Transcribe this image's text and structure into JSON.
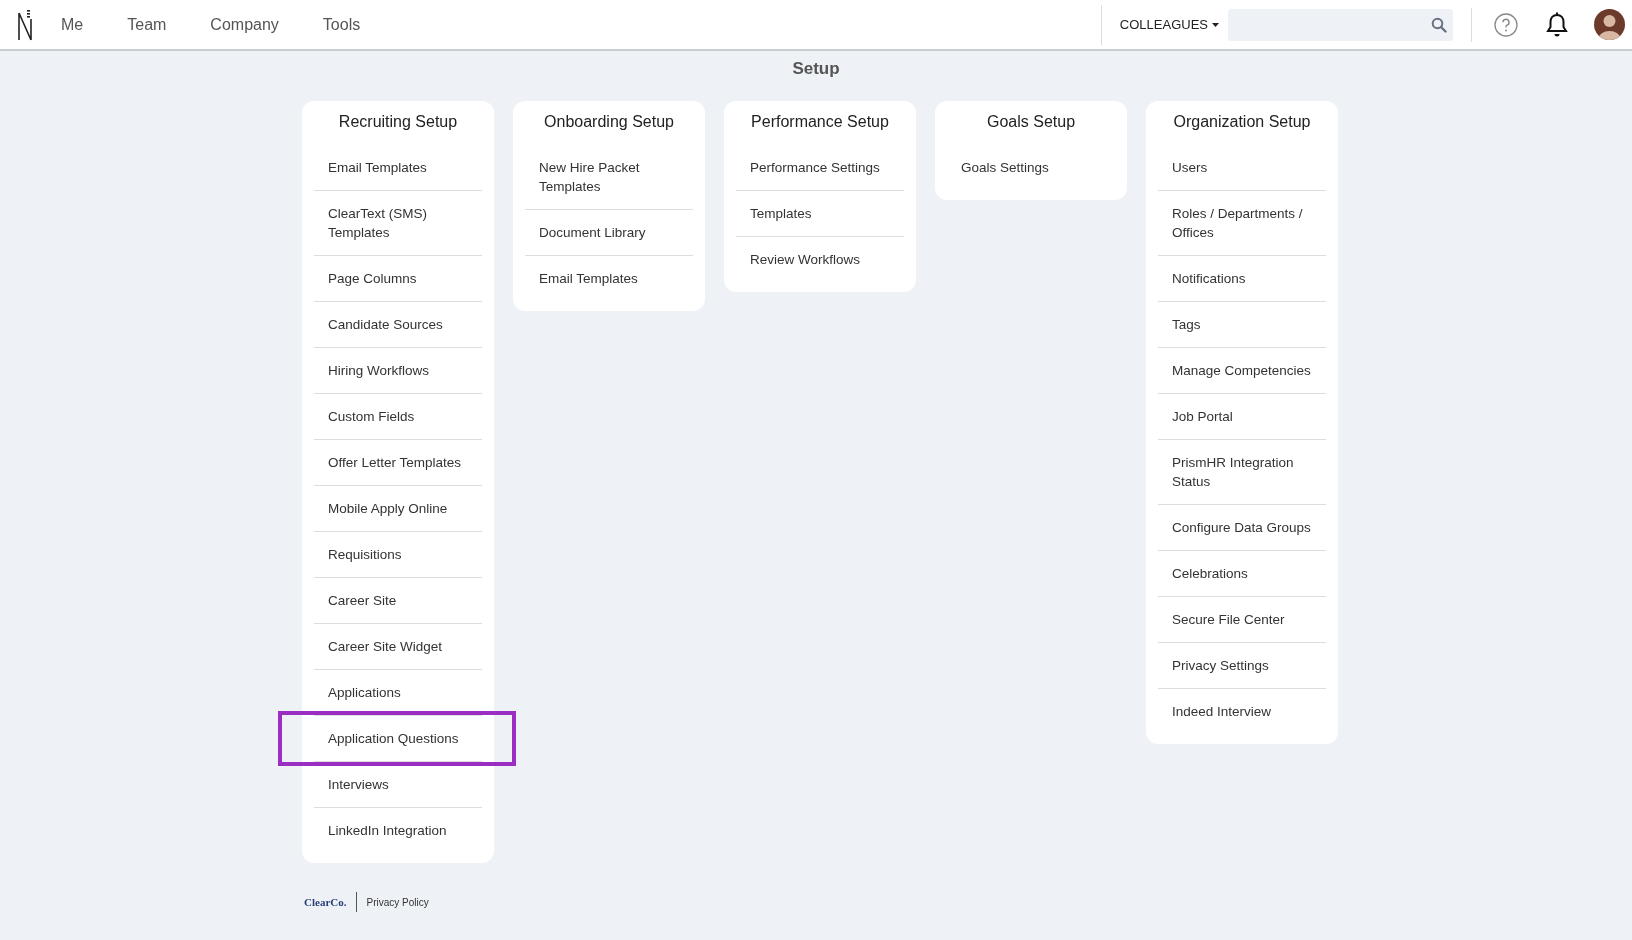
{
  "nav": {
    "items": [
      {
        "label": "Me",
        "selected": false
      },
      {
        "label": "Team",
        "selected": false
      },
      {
        "label": "Company",
        "selected": false
      },
      {
        "label": "Tools",
        "selected": false
      }
    ],
    "scope_dropdown": "COLLEAGUES"
  },
  "page_title": "Setup",
  "sections": [
    {
      "title": "Recruiting Setup",
      "items": [
        {
          "label": "Email Templates",
          "highlighted": false
        },
        {
          "label": "ClearText (SMS) Templates",
          "highlighted": false
        },
        {
          "label": "Page Columns",
          "highlighted": false
        },
        {
          "label": "Candidate Sources",
          "highlighted": false
        },
        {
          "label": "Hiring Workflows",
          "highlighted": false
        },
        {
          "label": "Custom Fields",
          "highlighted": false
        },
        {
          "label": "Offer Letter Templates",
          "highlighted": false
        },
        {
          "label": "Mobile Apply Online",
          "highlighted": false
        },
        {
          "label": "Requisitions",
          "highlighted": false
        },
        {
          "label": "Career Site",
          "highlighted": false
        },
        {
          "label": "Career Site Widget",
          "highlighted": false
        },
        {
          "label": "Applications",
          "highlighted": false
        },
        {
          "label": "Application Questions",
          "highlighted": true
        },
        {
          "label": "Interviews",
          "highlighted": false
        },
        {
          "label": "LinkedIn Integration",
          "highlighted": false
        }
      ]
    },
    {
      "title": "Onboarding Setup",
      "items": [
        {
          "label": "New Hire Packet Templates",
          "highlighted": false
        },
        {
          "label": "Document Library",
          "highlighted": false
        },
        {
          "label": "Email Templates",
          "highlighted": false
        }
      ]
    },
    {
      "title": "Performance Setup",
      "items": [
        {
          "label": "Performance Settings",
          "highlighted": false
        },
        {
          "label": "Templates",
          "highlighted": false
        },
        {
          "label": "Review Workflows",
          "highlighted": false
        }
      ]
    },
    {
      "title": "Goals Setup",
      "items": [
        {
          "label": "Goals Settings",
          "highlighted": false
        }
      ]
    },
    {
      "title": "Organization Setup",
      "items": [
        {
          "label": "Users",
          "highlighted": false
        },
        {
          "label": "Roles / Departments / Offices",
          "highlighted": false
        },
        {
          "label": "Notifications",
          "highlighted": false
        },
        {
          "label": "Tags",
          "highlighted": false
        },
        {
          "label": "Manage Competencies",
          "highlighted": false
        },
        {
          "label": "Job Portal",
          "highlighted": false
        },
        {
          "label": "PrismHR Integration Status",
          "highlighted": false
        },
        {
          "label": "Configure Data Groups",
          "highlighted": false
        },
        {
          "label": "Celebrations",
          "highlighted": false
        },
        {
          "label": "Secure File Center",
          "highlighted": false
        },
        {
          "label": "Privacy Settings",
          "highlighted": false
        },
        {
          "label": "Indeed Interview",
          "highlighted": false
        }
      ]
    }
  ],
  "footer": {
    "brand": "ClearCo.",
    "link": "Privacy Policy"
  }
}
